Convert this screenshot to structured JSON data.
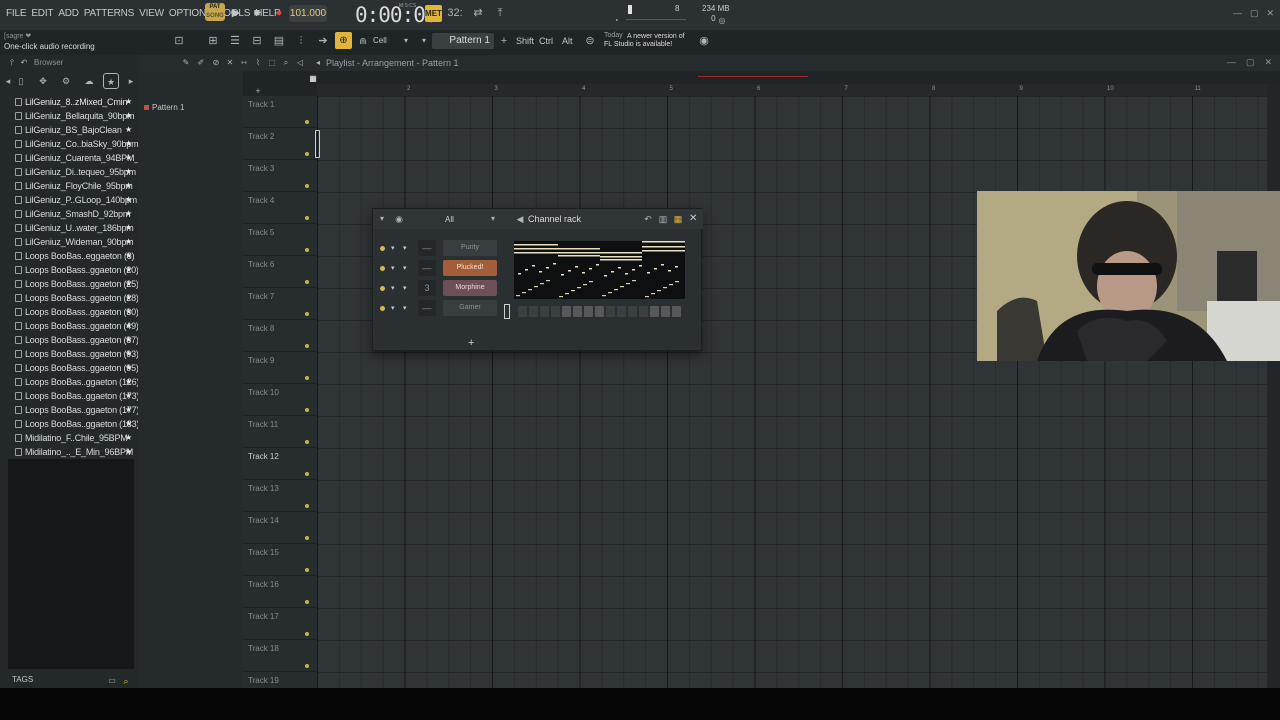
{
  "menu": [
    "FILE",
    "EDIT",
    "ADD",
    "PATTERNS",
    "VIEW",
    "OPTIONS",
    "TOOLS",
    "HELP"
  ],
  "transport": {
    "pat_song_top": "PAT",
    "pat_song_bottom": "SONG",
    "tempo": "101.000",
    "time": "0:00:00",
    "time_unit": "M:S:CS",
    "snap_label": "32:"
  },
  "system": {
    "cpu": "8",
    "memory_mb": "234 MB",
    "voices": "0"
  },
  "hint": {
    "title": "[sagre ❤",
    "text": "One-click audio recording"
  },
  "toolbar2": {
    "snap": "Cell",
    "pattern": "Pattern 1",
    "shift": "Shift",
    "ctrl": "Ctrl",
    "alt": "Alt",
    "news_title": "Today",
    "news_line1": "A newer version of",
    "news_line2": "FL Studio is available!"
  },
  "browser": {
    "title": "Browser",
    "items": [
      "LilGeniuz_8..zMixed_Cmin",
      "LilGeniuz_Bellaquita_90bpm",
      "LilGeniuz_BS_BajoClean",
      "LilGeniuz_Co..biaSky_90bpm",
      "LilGeniuz_Cuarenta_94BPM_",
      "LilGeniuz_Di..tequeo_95bpm",
      "LilGeniuz_FloyChile_95bpm",
      "LilGeniuz_P..GLoop_140bpm",
      "LilGeniuz_SmashD_92bpm",
      "LilGeniuz_U..water_186bpm",
      "LilGeniuz_Wideman_90bpm",
      "Loops BooBas..eggaeton (8)",
      "Loops BooBass..ggaeton (20)",
      "Loops BooBass..ggaeton (25)",
      "Loops BooBass..ggaeton (28)",
      "Loops BooBass..ggaeton (30)",
      "Loops BooBass..ggaeton (49)",
      "Loops BooBass..ggaeton (87)",
      "Loops BooBass..ggaeton (93)",
      "Loops BooBass..ggaeton (95)",
      "Loops BooBas..ggaeton (126)",
      "Loops BooBas..ggaeton (173)",
      "Loops BooBas..ggaeton (177)",
      "Loops BooBas..ggaeton (183)",
      "Midilatino_F..Chile_95BPM",
      "Midilatino_.._E_Min_96BPM"
    ],
    "tags_label": "TAGS"
  },
  "picker": {
    "pattern": "Pattern 1"
  },
  "playlist": {
    "title": "Playlist - Arrangement - Pattern 1",
    "ruler": [
      "2",
      "3",
      "4",
      "5",
      "6",
      "7",
      "8",
      "9",
      "10",
      "11"
    ],
    "tracks": [
      "Track 1",
      "Track 2",
      "Track 3",
      "Track 4",
      "Track 5",
      "Track 6",
      "Track 7",
      "Track 8",
      "Track 9",
      "Track 10",
      "Track 11",
      "Track 12",
      "Track 13",
      "Track 14",
      "Track 15",
      "Track 16",
      "Track 17",
      "Track 18",
      "Track 19"
    ],
    "highlighted_track": "Track 12"
  },
  "channel_rack": {
    "filter": "All",
    "title": "Channel rack",
    "channels": [
      {
        "name": "Purity",
        "number": "—",
        "style": "plain"
      },
      {
        "name": "Plucked!",
        "number": "—",
        "style": "orange"
      },
      {
        "name": "Morphine",
        "number": "3",
        "style": "mauve"
      },
      {
        "name": "Gamer",
        "number": "—",
        "style": "plain"
      }
    ],
    "add_label": "+"
  },
  "colors": {
    "accent": "#e1b53d",
    "plucked": "#a35d38",
    "morphine": "#6e4f57",
    "led": "#d3b94f"
  }
}
